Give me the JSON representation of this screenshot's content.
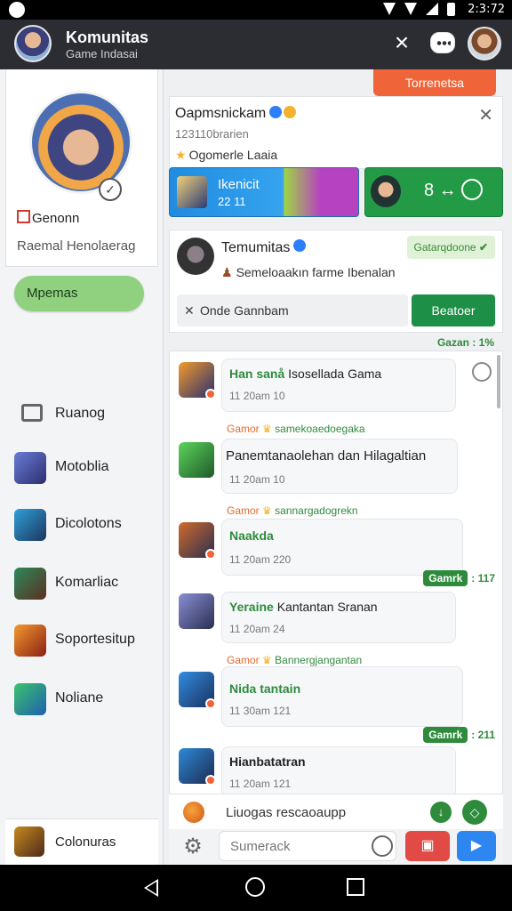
{
  "status": {
    "time": "2:3:72"
  },
  "header": {
    "title": "Komunitas",
    "subtitle": "Game Indasai"
  },
  "profile": {
    "name": "Genonn",
    "status": "Raemal Henolaerag"
  },
  "sidebar": {
    "active": "Mpemas",
    "items": [
      {
        "label": "Ruanog",
        "icon": "message-icon"
      },
      {
        "label": "Motoblia",
        "icon": "game-thumb"
      },
      {
        "label": "Dicolotons",
        "icon": "game-thumb"
      },
      {
        "label": "Komarliac",
        "icon": "game-thumb"
      },
      {
        "label": "Soportesitup",
        "icon": "game-thumb"
      },
      {
        "label": "Noliane",
        "icon": "game-thumb"
      }
    ],
    "footer": "Colonuras"
  },
  "top_button": "Torrenetsa",
  "info_card": {
    "title": "Oapmsnickam",
    "meta": "123110brarien",
    "tag": "Ogomerle Laaia"
  },
  "banners": {
    "blue": {
      "title": "Ikenicit",
      "sub": "22 11"
    },
    "green": {
      "icon1": "8 ↔",
      "icon2": "clock-icon"
    }
  },
  "community": {
    "title": "Temumitas",
    "subtitle": "Semeloaakın farme Ibenalan",
    "joined": "Gatarqdoone",
    "search_value": "Onde Gannbam",
    "action": "Beatoer"
  },
  "counter_top": {
    "label": "Gazan",
    "value": ": 1%"
  },
  "messages": [
    {
      "head": "Han sanå",
      "head2": "Isosellada Gama",
      "time": "11 20am 10"
    },
    {
      "sender": "Gamor",
      "sender_name": "samekoaedoegaka",
      "body": "Panemtanaolehan dan Hilagaltian",
      "time": "11 20am 10"
    },
    {
      "sender": "Gamor",
      "sender_name": "sannargadogrekn",
      "head": "Naakda",
      "time": "11 20am 220"
    },
    {
      "head": "Yeraine",
      "head2": "Kantantan Sranan",
      "time": "11 20am 24"
    },
    {
      "sender": "Gamor",
      "sender_name": "Bannergjangantan",
      "head": "Nida tantain",
      "time": "11 30am 121"
    },
    {
      "head": "Hianbatatran",
      "time": "11 20am 121"
    }
  ],
  "pills": [
    {
      "tag": "Gamrk",
      "value": ": 117"
    },
    {
      "tag": "Gamrk",
      "value": ": 211"
    }
  ],
  "composer_top": {
    "text": "Liuogas rescaoaupp"
  },
  "composer": {
    "placeholder": "Sumerack"
  }
}
